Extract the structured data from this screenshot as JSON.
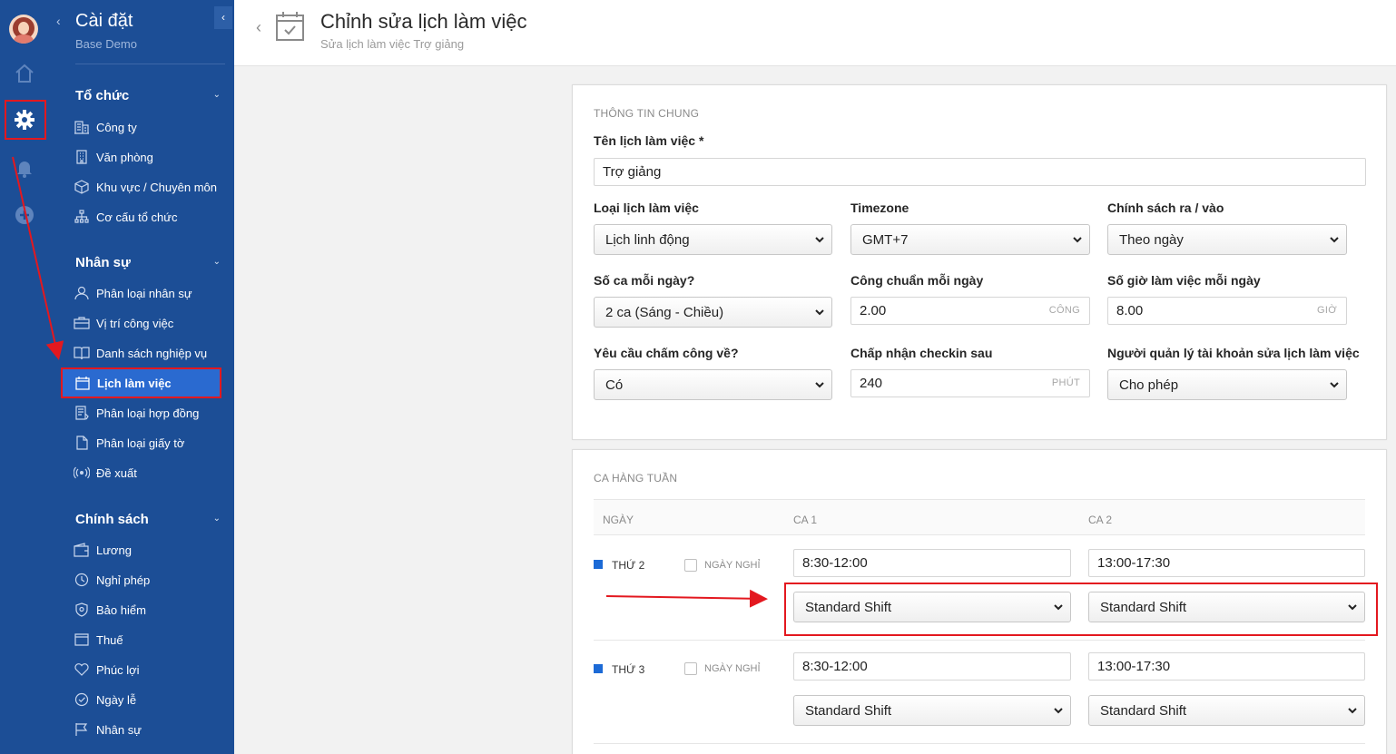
{
  "sidebar": {
    "title": "Cài đặt",
    "subtitle": "Base Demo",
    "sections": [
      {
        "label": "Tổ chức",
        "items": [
          {
            "label": "Công ty",
            "icon": "building-icon"
          },
          {
            "label": "Văn phòng",
            "icon": "office-icon"
          },
          {
            "label": "Khu vực / Chuyên môn",
            "icon": "cube-icon"
          },
          {
            "label": "Cơ cấu tổ chức",
            "icon": "org-chart-icon"
          }
        ]
      },
      {
        "label": "Nhân sự",
        "items": [
          {
            "label": "Phân loại nhân sự",
            "icon": "user-icon"
          },
          {
            "label": "Vị trí công việc",
            "icon": "briefcase-icon"
          },
          {
            "label": "Danh sách nghiệp vụ",
            "icon": "book-icon"
          },
          {
            "label": "Lịch làm việc",
            "icon": "calendar-icon",
            "active": true
          },
          {
            "label": "Phân loại hợp đồng",
            "icon": "contract-icon"
          },
          {
            "label": "Phân loại giấy tờ",
            "icon": "document-icon"
          },
          {
            "label": "Đề xuất",
            "icon": "broadcast-icon"
          }
        ]
      },
      {
        "label": "Chính sách",
        "items": [
          {
            "label": "Lương",
            "icon": "wallet-icon"
          },
          {
            "label": "Nghỉ phép",
            "icon": "clock-icon"
          },
          {
            "label": "Bảo hiểm",
            "icon": "shield-icon"
          },
          {
            "label": "Thuế",
            "icon": "receipt-icon"
          },
          {
            "label": "Phúc lợi",
            "icon": "heart-icon"
          },
          {
            "label": "Ngày lễ",
            "icon": "check-circle-icon"
          },
          {
            "label": "Nhân sự",
            "icon": "flag-icon"
          }
        ]
      }
    ]
  },
  "header": {
    "title": "Chỉnh sửa lịch làm việc",
    "subtitle": "Sửa lịch làm việc Trợ giảng"
  },
  "general": {
    "section_title": "THÔNG TIN CHUNG",
    "name_label": "Tên lịch làm việc *",
    "name_value": "Trợ giảng",
    "type_label": "Loại lịch làm việc",
    "type_value": "Lịch linh động",
    "timezone_label": "Timezone",
    "timezone_value": "GMT+7",
    "policy_label": "Chính sách ra / vào",
    "policy_value": "Theo ngày",
    "shifts_label": "Số ca mỗi ngày?",
    "shifts_value": "2 ca (Sáng - Chiều)",
    "standard_label": "Công chuẩn mỗi ngày",
    "standard_value": "2.00",
    "standard_unit": "CÔNG",
    "hours_label": "Số giờ làm việc mỗi ngày",
    "hours_value": "8.00",
    "hours_unit": "GIỜ",
    "checkout_label": "Yêu cầu chấm công về?",
    "checkout_value": "Có",
    "checkin_label": "Chấp nhận checkin sau",
    "checkin_value": "240",
    "checkin_unit": "PHÚT",
    "manager_label": "Người quản lý tài khoản sửa lịch làm việc",
    "manager_value": "Cho phép"
  },
  "weekly": {
    "section_title": "CA HÀNG TUẦN",
    "col_day": "NGÀY",
    "col_shift1": "CA 1",
    "col_shift2": "CA 2",
    "off_label": "NGÀY NGHỈ",
    "rows": [
      {
        "day": "THỨ 2",
        "shift1_time": "8:30-12:00",
        "shift2_time": "13:00-17:30",
        "shift1_type": "Standard Shift",
        "shift2_type": "Standard Shift"
      },
      {
        "day": "THỨ 3",
        "shift1_time": "8:30-12:00",
        "shift2_time": "13:00-17:30",
        "shift1_type": "Standard Shift",
        "shift2_type": "Standard Shift"
      }
    ]
  },
  "colors": {
    "sidebar": "#1c4e96",
    "active_item": "#2a6ad0",
    "annotation_red": "#e3181f"
  }
}
